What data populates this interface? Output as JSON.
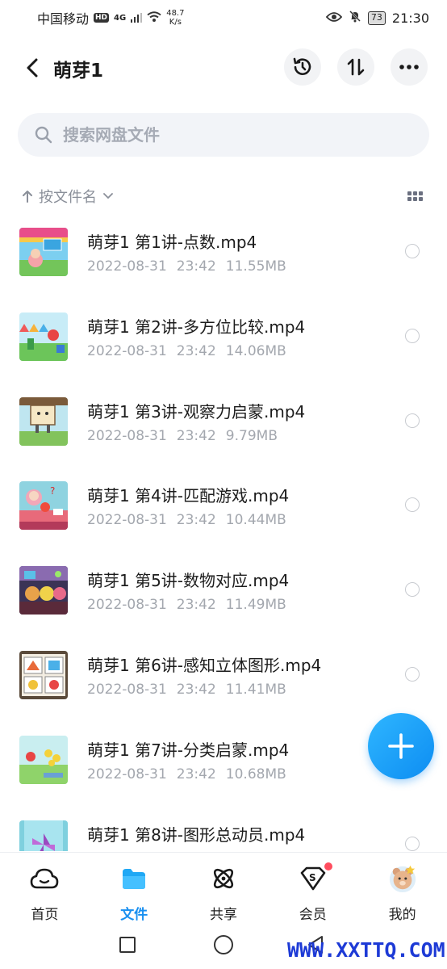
{
  "status_bar": {
    "carrier": "中国移动",
    "hd": "HD",
    "signal_type": "4G",
    "net_speed_value": "48.7",
    "net_speed_unit": "K/s",
    "battery": "73",
    "time": "21:30"
  },
  "header": {
    "title": "萌芽1"
  },
  "search": {
    "placeholder": "搜索网盘文件"
  },
  "sort": {
    "label": "按文件名"
  },
  "files": [
    {
      "name": "萌芽1 第1讲-点数.mp4",
      "date": "2022-08-31",
      "time": "23:42",
      "size": "11.55MB"
    },
    {
      "name": "萌芽1 第2讲-多方位比较.mp4",
      "date": "2022-08-31",
      "time": "23:42",
      "size": "14.06MB"
    },
    {
      "name": "萌芽1 第3讲-观察力启蒙.mp4",
      "date": "2022-08-31",
      "time": "23:42",
      "size": "9.79MB"
    },
    {
      "name": "萌芽1 第4讲-匹配游戏.mp4",
      "date": "2022-08-31",
      "time": "23:42",
      "size": "10.44MB"
    },
    {
      "name": "萌芽1 第5讲-数物对应.mp4",
      "date": "2022-08-31",
      "time": "23:42",
      "size": "11.49MB"
    },
    {
      "name": "萌芽1 第6讲-感知立体图形.mp4",
      "date": "2022-08-31",
      "time": "23:42",
      "size": "11.41MB"
    },
    {
      "name": "萌芽1 第7讲-分类启蒙.mp4",
      "date": "2022-08-31",
      "time": "23:42",
      "size": "10.68MB"
    },
    {
      "name": "萌芽1 第8讲-图形总动员.mp4",
      "date": "",
      "time": "",
      "size": ""
    }
  ],
  "bottom_nav": {
    "home": "首页",
    "files": "文件",
    "share": "共享",
    "vip": "会员",
    "mine": "我的"
  },
  "watermark": "WWW.XXTTQ.COM",
  "colors": {
    "accent": "#1a90f0",
    "fab": "#0d8df2",
    "badge": "#ff4d5e",
    "watermark": "#1d3ad6"
  }
}
